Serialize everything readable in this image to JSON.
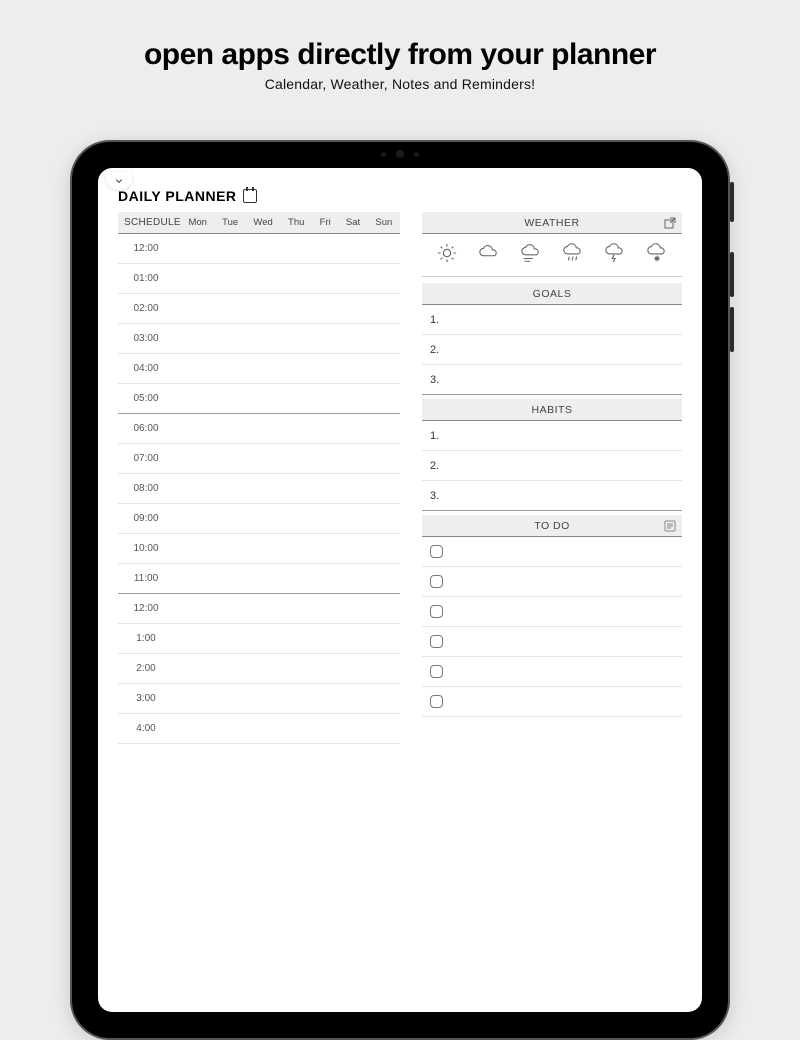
{
  "hero": {
    "title": "open apps directly from your planner",
    "subtitle": "Calendar, Weather, Notes and Reminders!"
  },
  "planner": {
    "title": "DAILY PLANNER",
    "schedule": {
      "label": "SCHEDULE",
      "days": [
        "Mon",
        "Tue",
        "Wed",
        "Thu",
        "Fri",
        "Sat",
        "Sun"
      ],
      "times": [
        "12:00",
        "01:00",
        "02:00",
        "03:00",
        "04:00",
        "05:00",
        "06:00",
        "07:00",
        "08:00",
        "09:00",
        "10:00",
        "11:00",
        "12:00",
        "1:00",
        "2:00",
        "3:00",
        "4:00"
      ]
    },
    "weather": {
      "label": "WEATHER"
    },
    "goals": {
      "label": "GOALS",
      "items": [
        "1.",
        "2.",
        "3."
      ]
    },
    "habits": {
      "label": "HABITS",
      "items": [
        "1.",
        "2.",
        "3."
      ]
    },
    "todo": {
      "label": "TO DO",
      "count": 6
    }
  }
}
